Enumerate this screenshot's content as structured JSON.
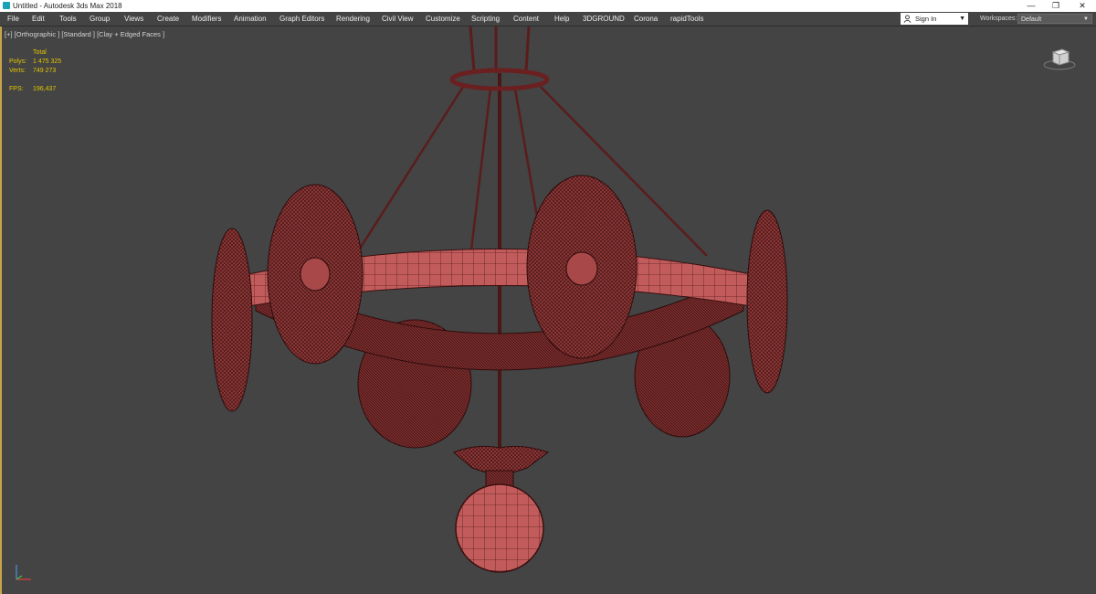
{
  "titlebar": {
    "title": "Untitled - Autodesk 3ds Max 2018",
    "minimize": "—",
    "restore": "❐",
    "close": "✕"
  },
  "menu": [
    "File",
    "Edit",
    "Tools",
    "Group",
    "Views",
    "Create",
    "Modifiers",
    "Animation",
    "Graph Editors",
    "Rendering",
    "Civil View",
    "Customize",
    "Scripting",
    "Content",
    "Help",
    "3DGROUND",
    "Corona",
    "rapidTools"
  ],
  "signin": {
    "label": "Sign In"
  },
  "workspaces": {
    "label": "Workspaces:",
    "value": "Default"
  },
  "viewport": {
    "label": "[+] [Orthographic ] [Standard ] [Clay + Edged Faces ]",
    "stats": {
      "header": "Total",
      "polys_label": "Polys:",
      "polys_value": "1 475 325",
      "verts_label": "Verts:",
      "verts_value": "749 273",
      "fps_label": "FPS:",
      "fps_value": "196,437"
    }
  },
  "colors": {
    "mesh_fill": "#a84848",
    "mesh_wire": "#3a1010",
    "stats": "#e2c500",
    "viewport_bg": "#444444"
  }
}
